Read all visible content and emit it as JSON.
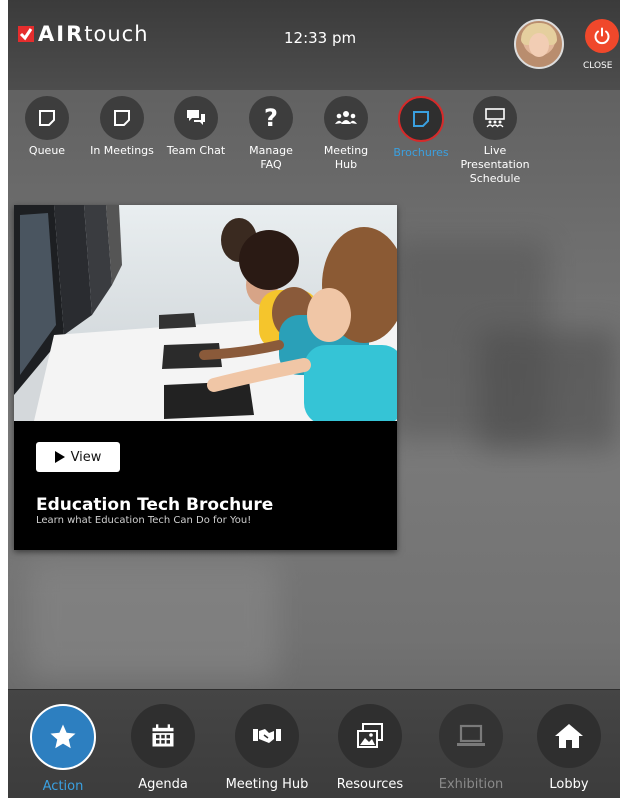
{
  "header": {
    "logo_brand_bold": "AIR",
    "logo_brand_rest": "touch",
    "time": "12:33 pm",
    "close_label": "CLOSE"
  },
  "toolbar": [
    {
      "label": "Queue",
      "icon": "note-icon"
    },
    {
      "label": "In Meetings",
      "icon": "note-icon"
    },
    {
      "label": "Team Chat",
      "icon": "chat-icon"
    },
    {
      "label": "Manage\nFAQ",
      "icon": "question-icon"
    },
    {
      "label": "Meeting\nHub",
      "icon": "group-icon"
    },
    {
      "label": "Brochures",
      "icon": "note-icon",
      "active": true
    },
    {
      "label": "Live\nPresentation\nSchedule",
      "icon": "presentation-icon"
    }
  ],
  "brochure": {
    "view_label": "View",
    "title": "Education Tech Brochure",
    "subtitle": "Learn what Education Tech Can Do for You!"
  },
  "bottom_nav": [
    {
      "label": "Action",
      "icon": "star-icon",
      "active": true
    },
    {
      "label": "Agenda",
      "icon": "calendar-icon"
    },
    {
      "label": "Meeting Hub",
      "icon": "handshake-icon"
    },
    {
      "label": "Resources",
      "icon": "images-icon"
    },
    {
      "label": "Exhibition",
      "icon": "laptop-icon",
      "disabled": true
    },
    {
      "label": "Lobby",
      "icon": "home-icon"
    }
  ],
  "colors": {
    "accent_blue": "#2d7fc0",
    "active_ring": "#d62a2a",
    "close_red": "#f0482b"
  }
}
